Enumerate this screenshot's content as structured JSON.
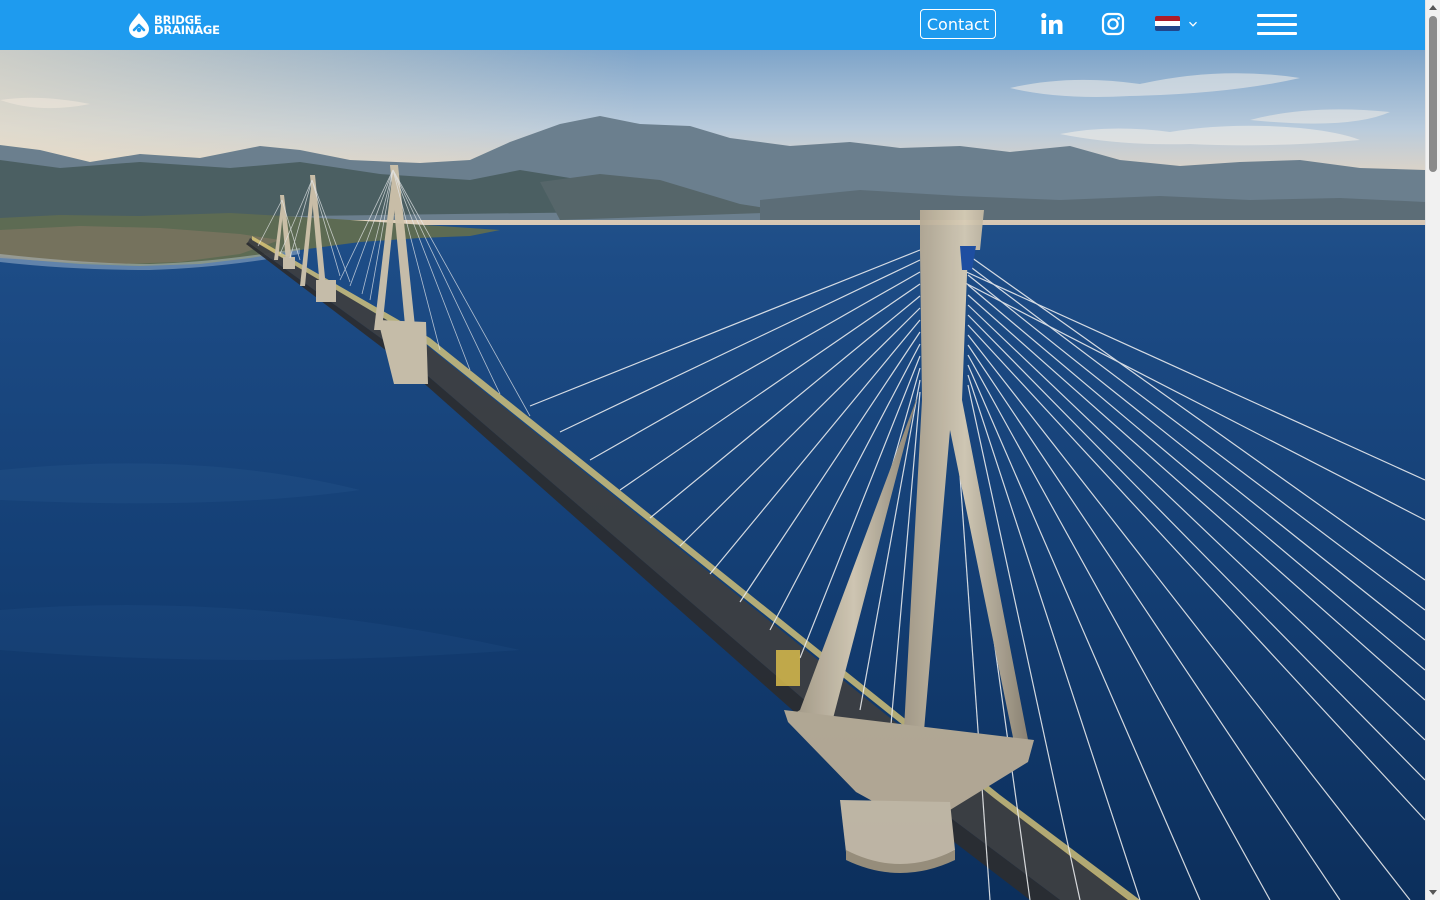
{
  "header": {
    "logo": {
      "line1": "BRIDGE",
      "line2": "DRAINAGE",
      "icon": "bridge-drainage-logo-icon"
    },
    "contact_label": "Contact",
    "social": [
      {
        "name": "linkedin",
        "icon": "linkedin-icon"
      },
      {
        "name": "instagram",
        "icon": "instagram-icon"
      }
    ],
    "language": {
      "flag": "netherlands-flag-icon",
      "colors": [
        "#ae1c28",
        "#ffffff",
        "#21468b"
      ]
    },
    "menu_icon": "hamburger-menu-icon"
  },
  "hero": {
    "image": "cable-stayed-bridge-over-sea-photo",
    "alt": ""
  },
  "colors": {
    "header_bg": "#1e9bef",
    "accent": "#ffffff"
  }
}
